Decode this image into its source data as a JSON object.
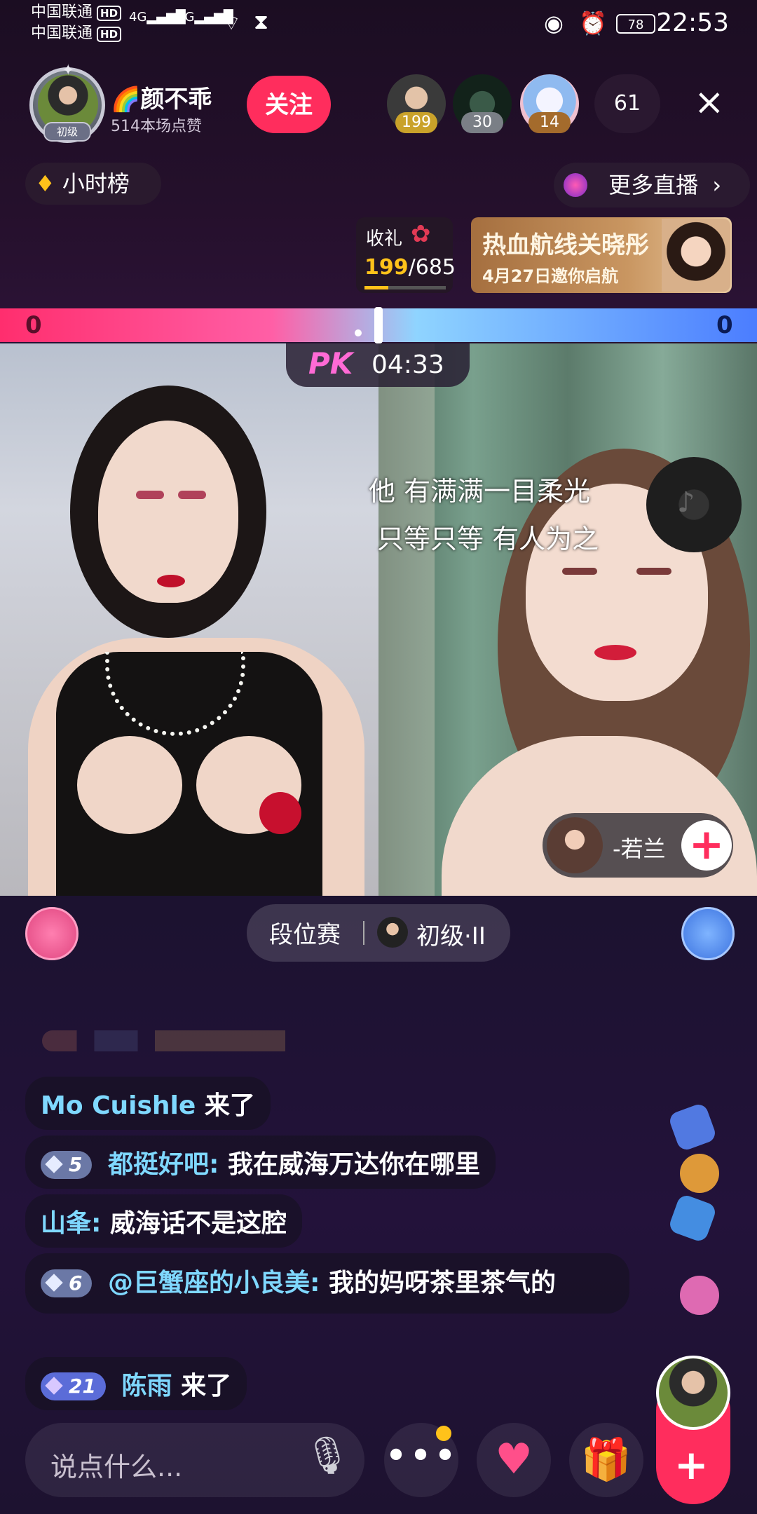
{
  "status_bar": {
    "carrier1": "中国联通",
    "carrier2": "中国联通",
    "hd": "HD",
    "signal1": "4G",
    "signal2": "4G",
    "battery": "78",
    "time": "22:53"
  },
  "header": {
    "host_name": "🌈颜不乖",
    "host_likes": "514本场点赞",
    "level_badge": "初级",
    "follow_label": "关注",
    "viewers": [
      {
        "count": "199",
        "color": "#c9a22a"
      },
      {
        "count": "30",
        "color": "#7a7f86"
      },
      {
        "count": "14",
        "color": "#a46b2c"
      }
    ],
    "online_count": "61",
    "close_icon": "×"
  },
  "hour_rank": {
    "label": "小时榜"
  },
  "more_live": {
    "label": "更多直播",
    "chevron": "›"
  },
  "gift_progress": {
    "label": "收礼",
    "current": "199",
    "total": "/685",
    "fraction": 0.29
  },
  "banner": {
    "title": "热血航线关晓彤",
    "subtitle": "4月27日邀你启航"
  },
  "pk": {
    "left_score": "0",
    "right_score": "0",
    "logo": "PK",
    "timer": "04:33",
    "left_share": 0.5
  },
  "lyrics": {
    "line1": "他 有满满一目柔光",
    "line2": "只等只等 有人为之"
  },
  "opponent": {
    "name": "-若兰",
    "plus": "+"
  },
  "rank": {
    "title": "段位赛",
    "level": "初级·II"
  },
  "chat": [
    {
      "nick": "Mo Cuishle",
      "text": "来了",
      "level": ""
    },
    {
      "nick": "都挺好吧:",
      "text": "我在威海万达你在哪里",
      "level": "5"
    },
    {
      "nick": "山夆:",
      "text": "威海话不是这腔",
      "level": ""
    },
    {
      "nick": "@巨蟹座的小良美:",
      "text": "我的妈呀茶里茶气的",
      "level": "6"
    },
    {
      "nick": "陈雨",
      "text": "来了",
      "level": "21"
    }
  ],
  "bottom": {
    "input_placeholder": "说点什么...",
    "plus": "+"
  },
  "colors": {
    "accent": "#ff2d5d",
    "nick": "#7fd8ff",
    "pk_left": "#ff2e6e",
    "pk_right": "#4b7dff"
  }
}
